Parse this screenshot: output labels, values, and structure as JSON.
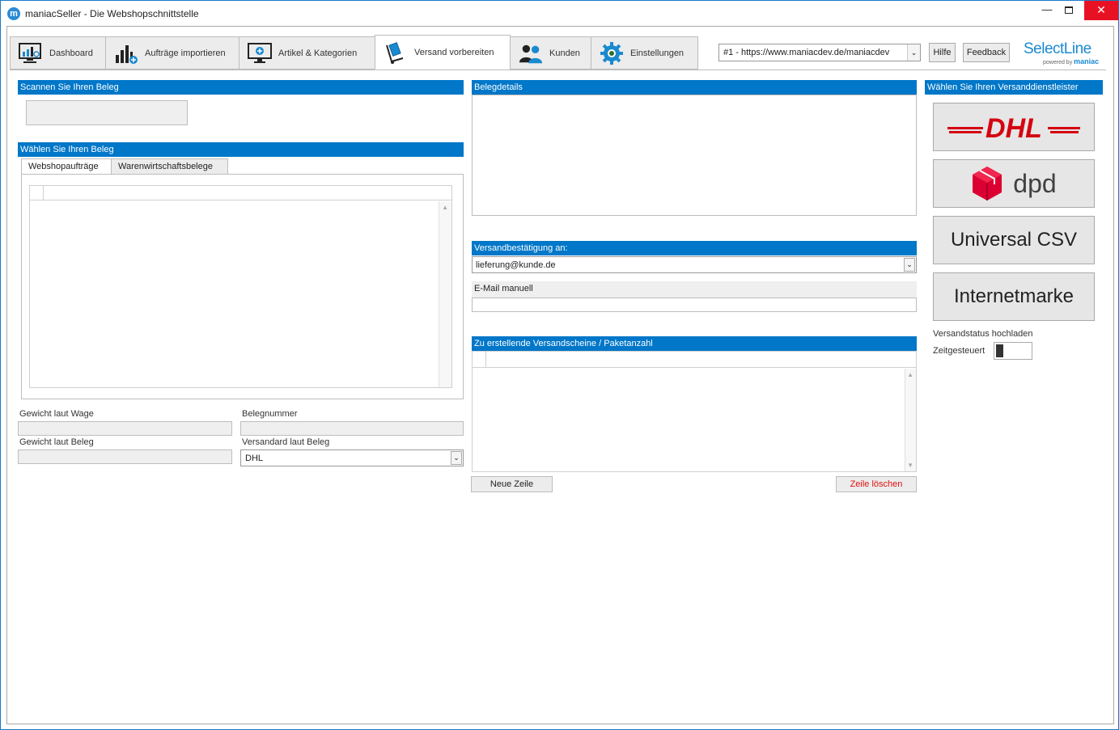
{
  "window": {
    "title": "maniacSeller - Die Webshopschnittstelle",
    "app_icon_letter": "m"
  },
  "tabs": [
    {
      "label": "Dashboard",
      "icon": "dashboard-icon"
    },
    {
      "label": "Aufträge importieren",
      "icon": "bar-chart-icon"
    },
    {
      "label": "Artikel & Kategorien",
      "icon": "monitor-icon"
    },
    {
      "label": "Versand vorbereiten",
      "icon": "hand-truck-icon",
      "active": true
    },
    {
      "label": "Kunden",
      "icon": "customers-icon"
    },
    {
      "label": "Einstellungen",
      "icon": "gear-icon"
    }
  ],
  "toolbar": {
    "shop_select_value": "#1 - https://www.maniacdev.de/maniacdev",
    "help_label": "Hilfe",
    "feedback_label": "Feedback",
    "brand_name": "SelectLine",
    "brand_powered": "powered by",
    "brand_maniac": "maniac"
  },
  "left": {
    "scan_header": "Scannen Sie Ihren Beleg",
    "choose_header": "Wählen Sie Ihren Beleg",
    "tab_webshop": "Webshopaufträge",
    "tab_warenwirtschaft": "Warenwirtschaftsbelege",
    "gewicht_wage_label": "Gewicht laut Wage",
    "belegnummer_label": "Belegnummer",
    "gewicht_beleg_label": "Gewicht laut Beleg",
    "versandart_label": "Versandard laut Beleg",
    "versandart_value": "DHL"
  },
  "middle": {
    "belegdetails_header": "Belegdetails",
    "confirmation_header": "Versandbestätigung an:",
    "confirmation_value": "lieferung@kunde.de",
    "email_manual_label": "E-Mail manuell",
    "shipments_header": "Zu erstellende Versandscheine / Paketanzahl",
    "new_row_label": "Neue Zeile",
    "delete_row_label": "Zeile löschen"
  },
  "right": {
    "carrier_header": "Wählen Sie Ihren Versanddienstleister",
    "carriers": {
      "dhl": "DHL",
      "dpd": "dpd",
      "csv": "Universal CSV",
      "internetmarke": "Internetmarke"
    },
    "status_upload_label": "Versandstatus hochladen",
    "scheduled_label": "Zeitgesteuert"
  },
  "colors": {
    "section_header": "#0077c8",
    "dhl_red": "#d40511",
    "dpd_red": "#dc0032",
    "delete_text": "#e01010"
  }
}
